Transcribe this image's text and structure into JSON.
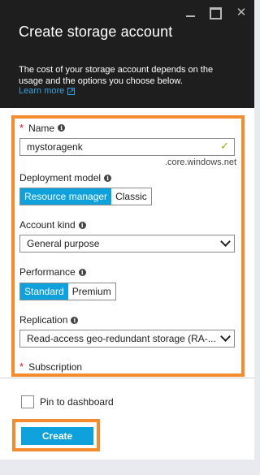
{
  "header": {
    "title": "Create storage account",
    "info": "The cost of your storage account depends on the usage and the options you choose below.",
    "learn_more": "Learn more",
    "window_controls": {
      "minimize": "minimize-icon",
      "maximize": "maximize-icon",
      "close": "close-icon"
    },
    "close_glyph": "✕"
  },
  "form": {
    "name": {
      "required_mark": "*",
      "label": "Name",
      "value": "mystoragenk",
      "suffix": ".core.windows.net",
      "valid_glyph": "✓"
    },
    "deployment_model": {
      "label": "Deployment model",
      "options": [
        "Resource manager",
        "Classic"
      ],
      "selected": "Resource manager"
    },
    "account_kind": {
      "label": "Account kind",
      "value": "General purpose"
    },
    "performance": {
      "label": "Performance",
      "options": [
        "Standard",
        "Premium"
      ],
      "selected": "Standard"
    },
    "replication": {
      "label": "Replication",
      "value": "Read-access geo-redundant storage (RA-..."
    },
    "subscription": {
      "required_mark": "*",
      "label": "Subscription"
    }
  },
  "footer": {
    "pin_label": "Pin to dashboard",
    "create_label": "Create"
  },
  "colors": {
    "header_bg": "#1e1e1e",
    "accent": "#0fa1dc",
    "highlight": "#f58b2f",
    "valid": "#7fba00",
    "required": "#e81123"
  }
}
